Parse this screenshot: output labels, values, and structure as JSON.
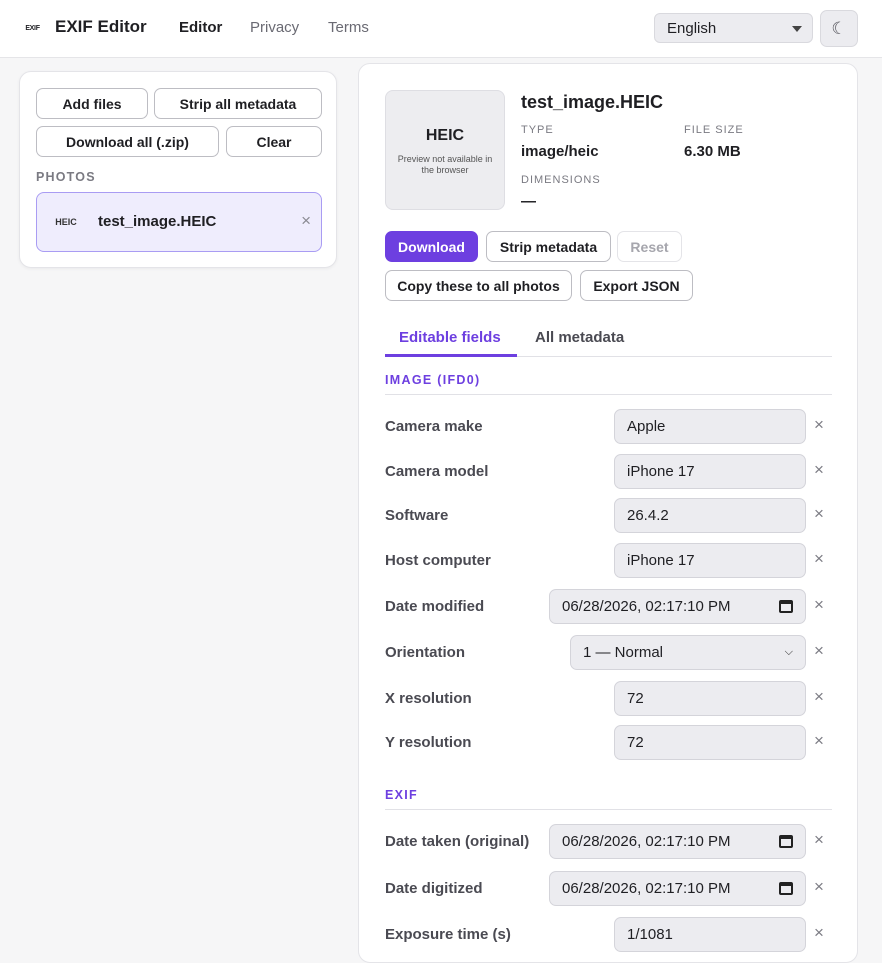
{
  "header": {
    "logo_text": "EXIF",
    "app_title": "EXIF Editor",
    "nav": [
      "Editor",
      "Privacy",
      "Terms"
    ],
    "language": "English",
    "theme_icon": "☾"
  },
  "sidebar": {
    "buttons": {
      "add_files": "Add files",
      "strip_all": "Strip all metadata",
      "download_all": "Download all (.zip)",
      "clear": "Clear"
    },
    "photos_label": "PHOTOS",
    "photos": [
      {
        "thumb": "HEIC",
        "name": "test_image.HEIC",
        "remove": "×"
      }
    ]
  },
  "detail": {
    "preview_format": "HEIC",
    "preview_note": "Preview not available in the browser",
    "file_name": "test_image.HEIC",
    "type_label": "TYPE",
    "type_value": "image/heic",
    "size_label": "FILE SIZE",
    "size_value": "6.30 MB",
    "dimensions_label": "DIMENSIONS",
    "dimensions_value": "—",
    "actions": {
      "download": "Download",
      "strip": "Strip metadata",
      "reset": "Reset",
      "copy_all": "Copy these to all photos",
      "export_json": "Export JSON"
    },
    "tabs": [
      "Editable fields",
      "All metadata"
    ],
    "groups": {
      "image": "IMAGE (IFD0)",
      "exif": "EXIF"
    },
    "image_fields": [
      {
        "label": "Camera make",
        "value": "Apple"
      },
      {
        "label": "Camera model",
        "value": "iPhone 17"
      },
      {
        "label": "Software",
        "value": "26.4.2"
      },
      {
        "label": "Host computer",
        "value": "iPhone 17"
      },
      {
        "label": "Date modified",
        "value": "06/28/2026, 02:17:10 PM"
      },
      {
        "label": "Orientation",
        "value": "1 — Normal"
      },
      {
        "label": "X resolution",
        "value": "72"
      },
      {
        "label": "Y resolution",
        "value": "72"
      }
    ],
    "exif_fields": [
      {
        "label": "Date taken (original)",
        "value": "06/28/2026, 02:17:10 PM"
      },
      {
        "label": "Date digitized",
        "value": "06/28/2026, 02:17:10 PM"
      },
      {
        "label": "Exposure time (s)",
        "value": "1/1081"
      }
    ],
    "clear_glyph": "×"
  },
  "colors": {
    "accent": "#6d3fe0",
    "selected_bg": "#efedfd",
    "input_bg": "#ececf0"
  }
}
